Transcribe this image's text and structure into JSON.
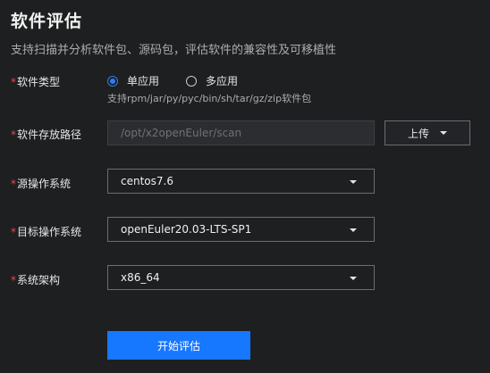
{
  "page": {
    "title": "软件评估",
    "subtitle": "支持扫描并分析软件包、源码包，评估软件的兼容性及可移植性"
  },
  "form": {
    "required_mark": "*",
    "software_type": {
      "label": "软件类型",
      "options": [
        {
          "label": "单应用",
          "checked": true
        },
        {
          "label": "多应用",
          "checked": false
        }
      ],
      "hint": "支持rpm/jar/py/pyc/bin/sh/tar/gz/zip软件包"
    },
    "storage_path": {
      "label": "软件存放路径",
      "value": "/opt/x2openEuler/scan",
      "upload_label": "上传"
    },
    "source_os": {
      "label": "源操作系统",
      "value": "centos7.6"
    },
    "target_os": {
      "label": "目标操作系统",
      "value": "openEuler20.03-LTS-SP1"
    },
    "arch": {
      "label": "系统架构",
      "value": "x86_64"
    },
    "submit_label": "开始评估"
  },
  "colors": {
    "background": "#1e1f20",
    "primary": "#1677ff",
    "required": "#e5484d",
    "muted_text": "#a9adb3"
  },
  "icons": {
    "dropdown": "caret-down-icon"
  }
}
